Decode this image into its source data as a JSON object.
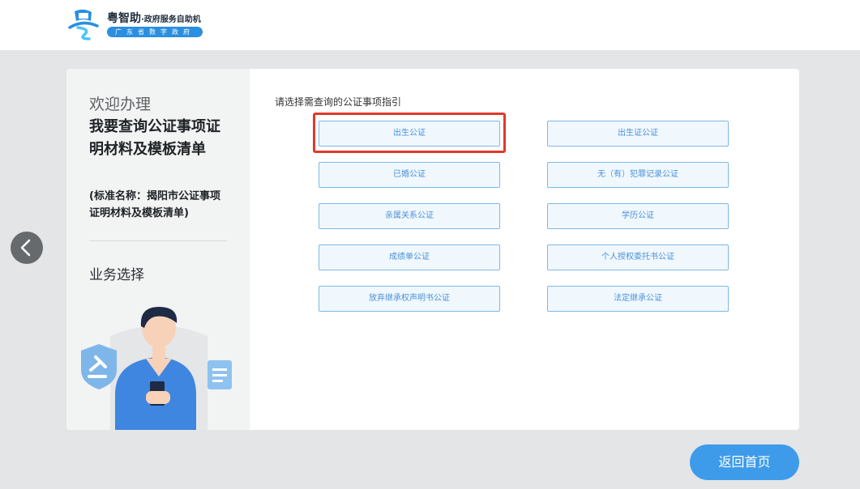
{
  "header": {
    "brand_name": "粤智助",
    "brand_subtitle": "·政府服务自助机",
    "brand_tagline": "广东省数字政府",
    "logo_icon": "yue-logo-icon"
  },
  "sidebar": {
    "welcome": "欢迎办理",
    "title": "我要查询公证事项证明材料及模板清单",
    "standard_name": "(标准名称：揭阳市公证事项证明材料及模板清单)",
    "section_label": "业务选择"
  },
  "main": {
    "prompt": "请选择需查询的公证事项指引",
    "selected_option": "出生公证",
    "options": [
      {
        "label": "出生公证"
      },
      {
        "label": "出生证公证"
      },
      {
        "label": "已婚公证"
      },
      {
        "label": "无（有）犯罪记录公证"
      },
      {
        "label": "亲属关系公证"
      },
      {
        "label": "学历公证"
      },
      {
        "label": "成绩单公证"
      },
      {
        "label": "个人授权委托书公证"
      },
      {
        "label": "放弃继承权声明书公证"
      },
      {
        "label": "法定继承公证"
      }
    ]
  },
  "nav": {
    "back_icon": "chevron-left-icon",
    "home_button": "返回首页"
  },
  "colors": {
    "accent": "#3d9bea",
    "option_border": "#7fb8e6",
    "option_text": "#4a90d9",
    "highlight": "#e0392b"
  }
}
